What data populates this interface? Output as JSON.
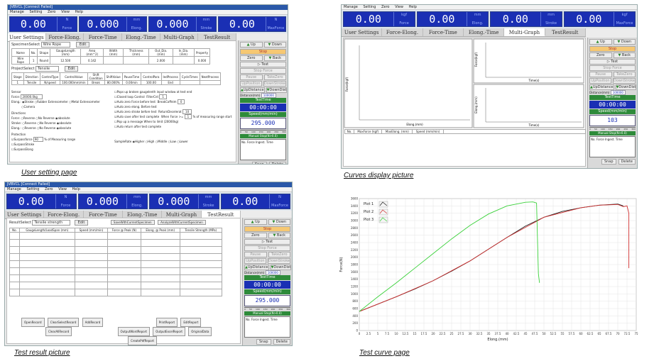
{
  "captions": {
    "q1": "User setting page",
    "q2": "Curves display picture",
    "q3": "Test result picture",
    "q4": "Test curve page"
  },
  "app": {
    "window_title": "JVBVCL  [Connect Failed]",
    "menu": [
      "Manage",
      "Setting",
      "Zero",
      "View",
      "Help"
    ],
    "readouts": [
      {
        "value": "0.00",
        "unit_top": "N",
        "unit_bottom": "Force"
      },
      {
        "value": "0.000",
        "unit_top": "mm",
        "unit_bottom": "Elong."
      },
      {
        "value": "0.000",
        "unit_top": "mm",
        "unit_bottom": "Stroke"
      },
      {
        "value": "0.00",
        "unit_top": "N",
        "unit_bottom": "MaxForce"
      }
    ],
    "readouts_q2": [
      {
        "value": "0.00",
        "unit_top": "kgf",
        "unit_bottom": "Force"
      },
      {
        "value": "0.00",
        "unit_top": "mm",
        "unit_bottom": "Elong."
      },
      {
        "value": "0.00",
        "unit_top": "mm",
        "unit_bottom": "Stroke"
      },
      {
        "value": "0.00",
        "unit_top": "kgf",
        "unit_bottom": "MaxForce"
      }
    ],
    "tabs": [
      "User Settings",
      "Force-Elong.",
      "Force-Time",
      "Elong.-Time",
      "Multi-Graph",
      "TestResult"
    ],
    "right": {
      "up": "Up",
      "down": "Down",
      "stop": "Stop",
      "zero": "Zero",
      "back": "Back",
      "test": "Test",
      "stop2": "Stop Force",
      "pause": "Pause",
      "take": "TakeZero",
      "upaccel": "UpPosition",
      "downaccel": "DownStroke",
      "updistance": "UpDistance",
      "downdist": "DownDist",
      "distance_label": "Distance(mm)",
      "distance_val": "100000",
      "test_time": "TestTime",
      "time_val": "00:00:00",
      "speed_label": "Speed(mm/min)",
      "speed_val": "295.000",
      "speed_val_q2": "103",
      "scale": [
        "0",
        "50",
        "100",
        "150",
        "200",
        "250",
        "300"
      ],
      "manual": "Manual Stop(N>0.0)",
      "manual_row": "No.   Force   Ingest.   Time",
      "snap": "Snap",
      "delete": "Delete"
    }
  },
  "settings": {
    "specimen_label": "SpecimenSelect",
    "specimen_val": "Wire Rope",
    "edit": "Edit",
    "spec_headers": [
      "Name",
      "No.",
      "Shape",
      "GaugeLength (mm)",
      "Area (mm^2)",
      "Width (mm)",
      "Thickness (mm)",
      "Out_Dia. (mm)",
      "In_Dia. (mm)",
      "Property"
    ],
    "spec_row": [
      "Wire Rope",
      "1",
      "Round",
      "12.500",
      "0.142",
      "",
      "",
      "2.000",
      "",
      "0.000"
    ],
    "project_label": "ProjectSelect",
    "project_val": "Tensile",
    "proj_headers": [
      "Stage",
      "Direction",
      "ControlType",
      "ControlValue",
      "Shift Condition",
      "ShiftValue",
      "PauseTime",
      "ControlPara",
      "ledProcess",
      "CycleTimes",
      "NextProcess"
    ],
    "proj_row": [
      "1",
      "Tensile",
      "N/speed",
      "100.000mm/min",
      "Break",
      "80.000%",
      "0.00min",
      "100.00",
      "End",
      "",
      ""
    ],
    "sensor": "Sensor",
    "force_label": "Force:",
    "force_val": "20000.0kg",
    "elong_label": "Elong.:",
    "stroke": "Stroke",
    "rubber": "Rubber Extensometer",
    "metal": "Metal Extensometer",
    "camera": "Camera",
    "directions": "Directions",
    "dir_force": "Force:",
    "dir_stroke": "Stroke:",
    "dir_elong": "Elong.:",
    "no_reverse": "No Reverse",
    "reverse": "Reverse",
    "absolute": "absolute",
    "protection": "Protection",
    "surpass_force": "Surpassforce",
    "surpass_val": "90",
    "pct_range": "% of Measuring range",
    "surpass_stroke": "SurpassStroke",
    "surpass_elong": "SurpassElong",
    "opts": [
      "Pops up broken gaugelenth input window at test end",
      "Closed loop Control",
      "Auto zero Force before test",
      "Auto zero elong. Before test",
      "Auto zero stroke before test",
      "Auto save after test complete",
      "Pop up a message When to limit",
      "Auto return after test complete"
    ],
    "filter_label": "FilterCnt",
    "filter_val": "1",
    "break_label": "BreakCoffeim",
    "break_val": "0",
    "return_label": "ReturnDecelerat",
    "return_val": "10",
    "when_force": "When Force >=",
    "when_val": "1",
    "when_pct": "% of measuring range start",
    "when_unit": "(20000kg)",
    "sample_rate": "SampleRate",
    "rates": [
      "Higher",
      "High",
      "Middle",
      "Low",
      "Lower"
    ]
  },
  "curves": {
    "x_label": "Elong.(mm)",
    "y1": "Force(kgf)",
    "y2": "Force(kgf)",
    "y3": "Elong.(mm)",
    "xt": "Time(s)",
    "xt2": "Time(s)",
    "table_headers": [
      "No.",
      "MaxForce (kgf)",
      "MaxElong. (mm)",
      "Speed (mm/min)"
    ]
  },
  "result": {
    "select_label": "ResultSelect",
    "select_val": "Tensile strength",
    "edit": "Edit",
    "save_btn": "SaveWithCurrentSpecimen",
    "analyze_btn": "AnalyzeWithCurrentSpecimen",
    "headers": [
      "No.",
      "GaugeLength/LoadSpan (mm)",
      "Speed (mm/min)",
      "Force @ Peak (N)",
      "Elong. @ Peak (mm)",
      "Tensile Strength (MPa)"
    ],
    "buttons1": [
      "OpenRecord",
      "ClearSelectRecord",
      "AddRecord",
      "PrintReport",
      "EditReport"
    ],
    "buttons2": [
      "ClearAllRecord",
      "OutputWordReport",
      "OutputExcelReport",
      "OriginalData"
    ],
    "buttons3": [
      "CreatePdfReport"
    ]
  },
  "chart_data": {
    "type": "line",
    "xlabel": "Elong.(mm)",
    "ylabel": "Force(N)",
    "xlim": [
      0,
      75
    ],
    "ylim": [
      0,
      3600
    ],
    "x_ticks": [
      "0",
      "2.5",
      "5",
      "7.5",
      "10",
      "12.5",
      "15",
      "17.5",
      "20",
      "22.5",
      "25",
      "27.5",
      "30",
      "32.5",
      "35",
      "37.5",
      "40",
      "42.5",
      "45",
      "47.5",
      "50",
      "52.5",
      "55",
      "57.5",
      "60",
      "62.5",
      "65",
      "67.5",
      "70",
      "72.5",
      "75"
    ],
    "y_ticks": [
      "0",
      "200",
      "400",
      "600",
      "800",
      "1000",
      "1200",
      "1400",
      "1600",
      "1800",
      "2000",
      "2200",
      "2400",
      "2600",
      "2800",
      "3000",
      "3200",
      "3400",
      "3600"
    ],
    "grid": true,
    "legend": "top-left",
    "series": [
      {
        "name": "Plot 1",
        "color": "#222222",
        "x": [
          0,
          5,
          10,
          15,
          20,
          25,
          30,
          35,
          40,
          45,
          50,
          55,
          60,
          65,
          70,
          71.5
        ],
        "y": [
          520,
          720,
          920,
          1130,
          1360,
          1620,
          1900,
          2220,
          2540,
          2850,
          3090,
          3250,
          3350,
          3420,
          3450,
          3400
        ]
      },
      {
        "name": "Plot 2",
        "color": "#d03030",
        "x": [
          0,
          10,
          20,
          30,
          40,
          50,
          60,
          65,
          70,
          71.5,
          72.5,
          73,
          73
        ],
        "y": [
          520,
          920,
          1360,
          1900,
          2540,
          3090,
          3350,
          3420,
          3440,
          3380,
          3400,
          3200,
          1700
        ]
      },
      {
        "name": "Plot 3",
        "color": "#3ad13a",
        "x": [
          0,
          5,
          10,
          15,
          20,
          25,
          30,
          35,
          40,
          45,
          47,
          48,
          48.5,
          48.8
        ],
        "y": [
          520,
          920,
          1300,
          1700,
          2100,
          2500,
          2870,
          3180,
          3400,
          3500,
          3510,
          3480,
          1550,
          1300
        ]
      }
    ]
  }
}
